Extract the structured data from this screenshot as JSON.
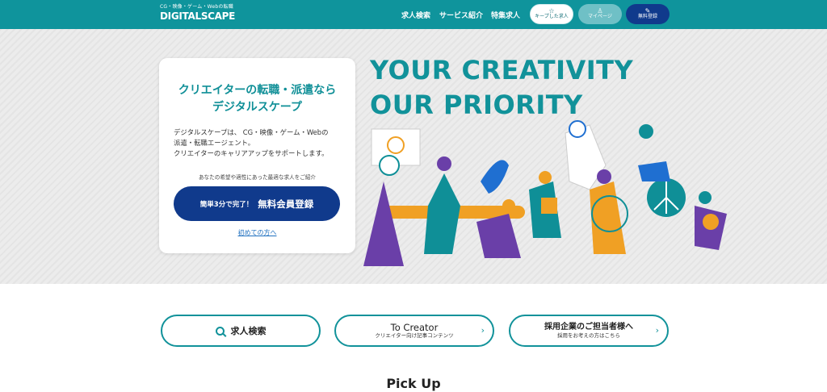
{
  "header": {
    "tagline": "CG・映像・ゲーム・Webの転職",
    "logo": "DIGITALSCAPE",
    "nav": [
      "求人検索",
      "サービス紹介",
      "特集求人"
    ],
    "keep_label": "キープした求人",
    "mypage_label": "マイページ",
    "free_label": "無料登録"
  },
  "hero": {
    "title_line1": "クリエイターの転職・派遣なら",
    "title_line2": "デジタルスケープ",
    "desc_line1": "デジタルスケープは、 CG・映像・ゲーム・Webの",
    "desc_line2": "派遣・転職エージェント。",
    "desc_line3": "クリエイターのキャリアアップをサポートします。",
    "sub": "あなたの希望や適性にあった最適な求人をご紹介",
    "cta_small": "簡単3分で完了！",
    "cta_big": "無料会員登録",
    "first_link": "初めての方へ",
    "headline1": "YOUR CREATIVITY",
    "headline2": "OUR PRIORITY"
  },
  "links": {
    "search": "求人検索",
    "creator_title": "To Creator",
    "creator_sub": "クリエイター向け記事コンテンツ",
    "company_title": "採用企業のご担当者様へ",
    "company_sub": "採用をお考えの方はこちら"
  },
  "pickup": "Pick Up",
  "colors": {
    "teal": "#11929a",
    "navy": "#103a8c",
    "orange": "#f0a024",
    "purple": "#6a3fa8"
  }
}
